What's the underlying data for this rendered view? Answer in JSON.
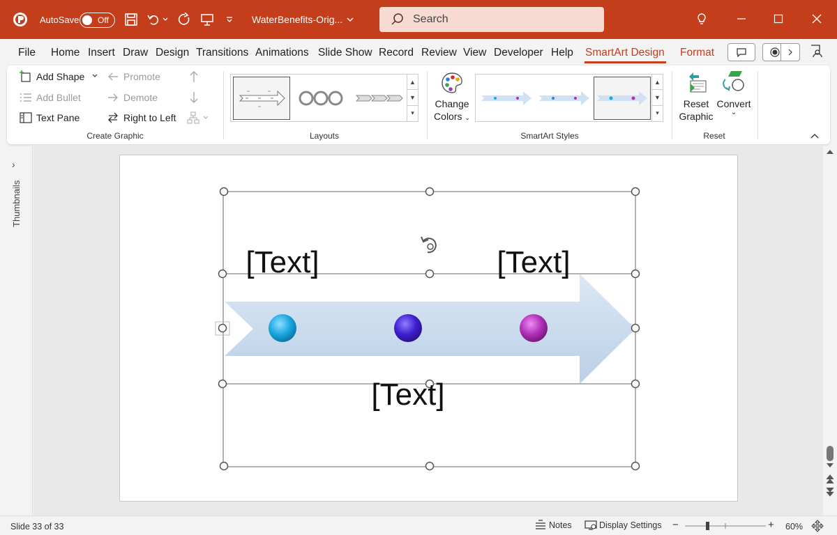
{
  "titlebar": {
    "autosave_label": "AutoSave",
    "autosave_state": "Off",
    "doc_title": "WaterBenefits-Orig...",
    "search_placeholder": "Search"
  },
  "tabs": [
    "File",
    "Home",
    "Insert",
    "Draw",
    "Design",
    "Transitions",
    "Animations",
    "Slide Show",
    "Record",
    "Review",
    "View",
    "Developer",
    "Help",
    "SmartArt Design",
    "Format"
  ],
  "active_tab": "SmartArt Design",
  "ribbon": {
    "create_graphic": {
      "label": "Create Graphic",
      "add_shape": "Add Shape",
      "add_bullet": "Add Bullet",
      "text_pane": "Text Pane",
      "promote": "Promote",
      "demote": "Demote",
      "right_to_left": "Right to Left"
    },
    "layouts": {
      "label": "Layouts"
    },
    "change_colors": {
      "line1": "Change",
      "line2": "Colors"
    },
    "smartart_styles": {
      "label": "SmartArt Styles"
    },
    "reset": {
      "label": "Reset",
      "reset_graphic_line1": "Reset",
      "reset_graphic_line2": "Graphic",
      "convert": "Convert"
    }
  },
  "thumbnails_label": "Thumbnails",
  "slide": {
    "text_top_left": "[Text]",
    "text_top_right": "[Text]",
    "text_bottom": "[Text]",
    "dot_colors": [
      "#1aa7e0",
      "#3f1fd0",
      "#b02fb8"
    ]
  },
  "statusbar": {
    "slide_info": "Slide 33 of 33",
    "notes": "Notes",
    "display_settings": "Display Settings",
    "zoom": "60%"
  },
  "colors": {
    "accent": "#c43e1c",
    "search_bg": "#f7dbd3"
  }
}
